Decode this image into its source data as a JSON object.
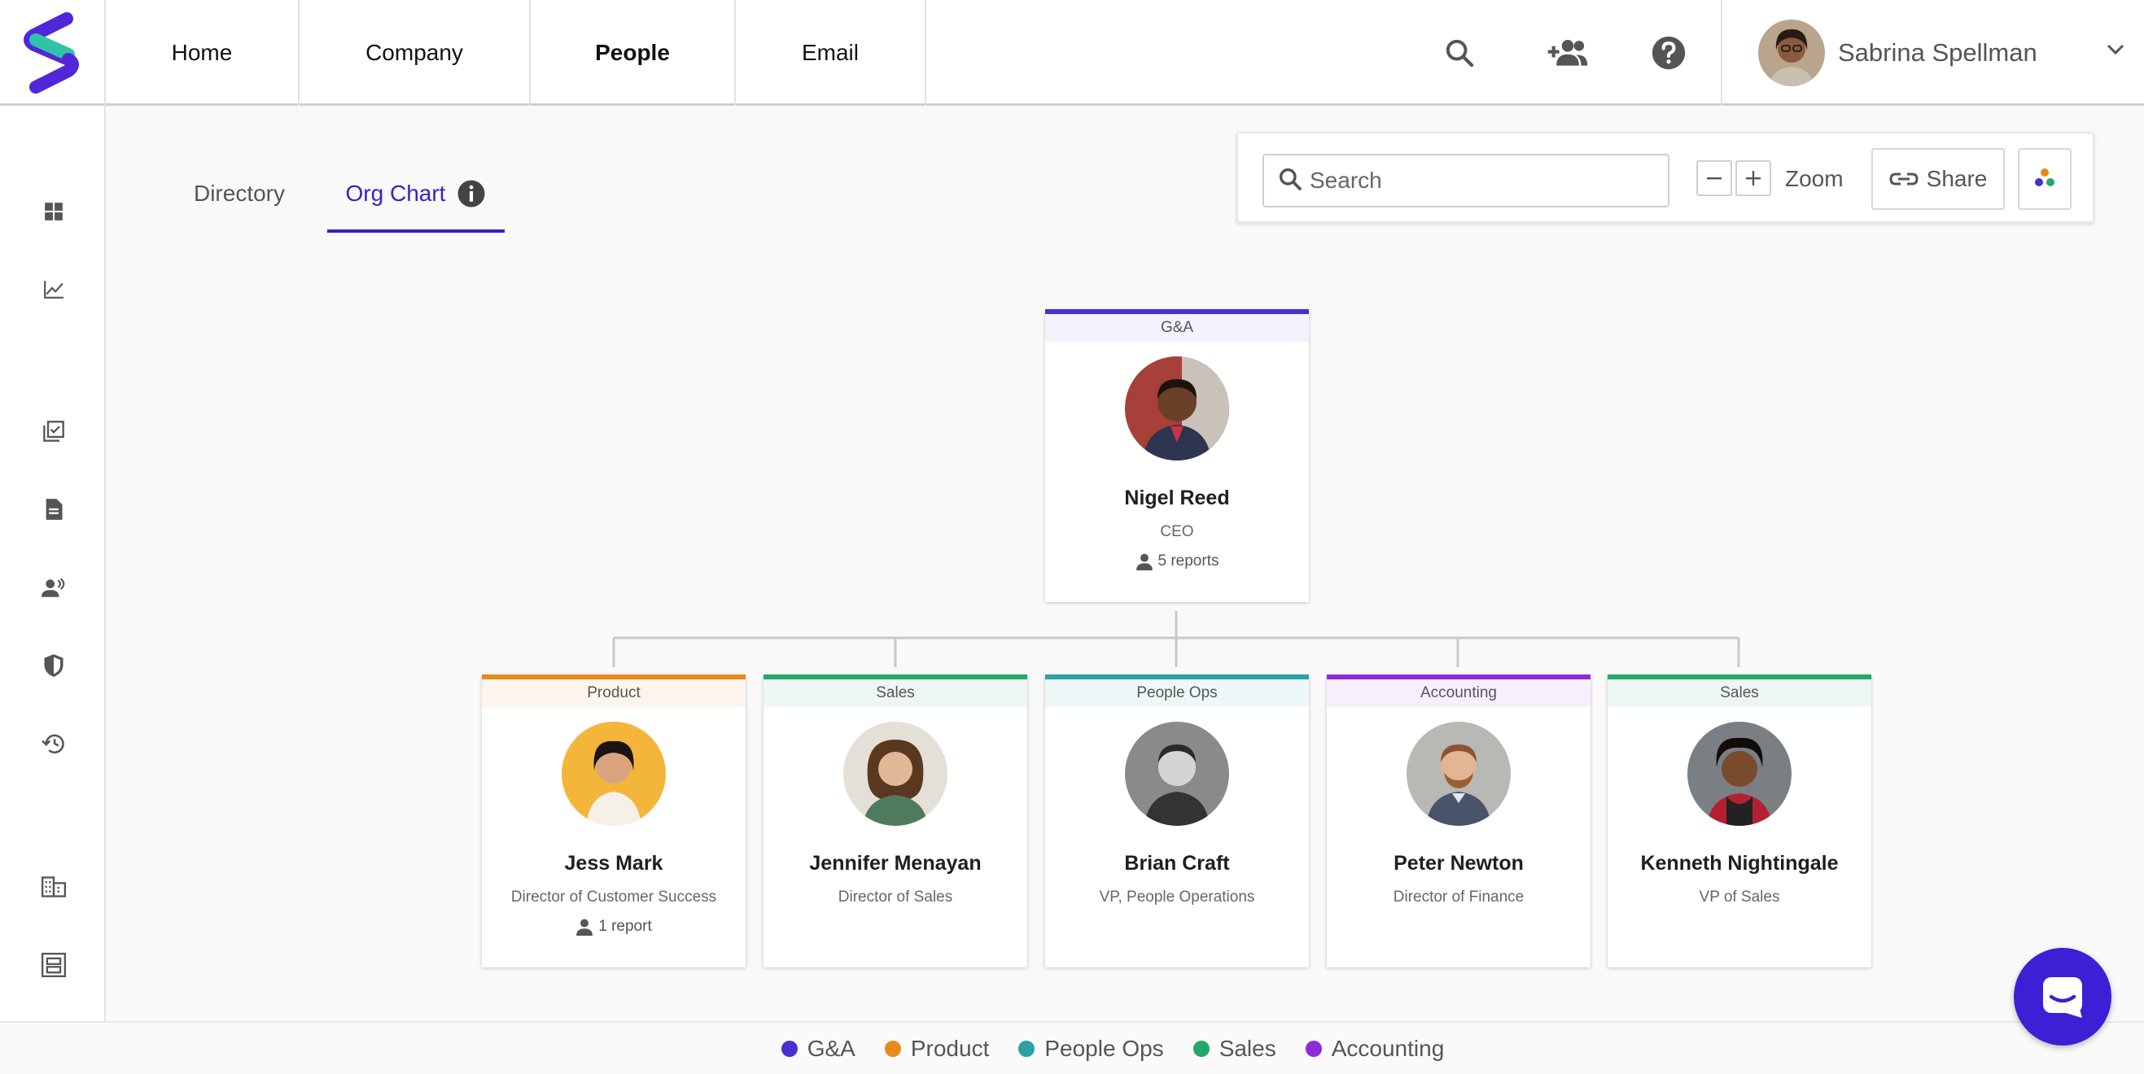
{
  "nav": {
    "items": [
      {
        "label": "Home"
      },
      {
        "label": "Company"
      },
      {
        "label": "People"
      },
      {
        "label": "Email"
      }
    ],
    "active": "People"
  },
  "topbar": {
    "icons": [
      "search-icon",
      "add-people-icon",
      "help-icon"
    ],
    "user_name": "Sabrina Spellman"
  },
  "sidebar": {
    "icons": [
      "dashboard-icon",
      "analytics-icon",
      "tasks-icon",
      "document-icon",
      "people-icon",
      "security-icon",
      "history-icon",
      "company-icon",
      "org-structure-icon"
    ]
  },
  "tabs": {
    "directory": "Directory",
    "org_chart": "Org Chart",
    "active": "Org Chart"
  },
  "toolbar": {
    "search_placeholder": "Search",
    "zoom_label": "Zoom",
    "share_label": "Share"
  },
  "colors": {
    "ga": "#4a2fd0",
    "product": "#e8891e",
    "people_ops": "#2aa1a3",
    "sales": "#23a869",
    "accounting": "#8f2bd6",
    "accent": "#3a1fc5"
  },
  "org": {
    "root": {
      "dept": "G&A",
      "name": "Nigel Reed",
      "title": "CEO",
      "reports": "5 reports"
    },
    "children": [
      {
        "dept": "Product",
        "name": "Jess Mark",
        "title": "Director of Customer Success",
        "reports": "1 report"
      },
      {
        "dept": "Sales",
        "name": "Jennifer Menayan",
        "title": "Director of Sales"
      },
      {
        "dept": "People Ops",
        "name": "Brian Craft",
        "title": "VP, People Operations"
      },
      {
        "dept": "Accounting",
        "name": "Peter Newton",
        "title": "Director of Finance"
      },
      {
        "dept": "Sales",
        "name": "Kenneth Nightingale",
        "title": "VP of Sales"
      }
    ]
  },
  "legend": [
    {
      "label": "G&A",
      "color": "#4a2fd0"
    },
    {
      "label": "Product",
      "color": "#e8891e"
    },
    {
      "label": "People Ops",
      "color": "#2aa1a3"
    },
    {
      "label": "Sales",
      "color": "#23a869"
    },
    {
      "label": "Accounting",
      "color": "#8f2bd6"
    }
  ]
}
